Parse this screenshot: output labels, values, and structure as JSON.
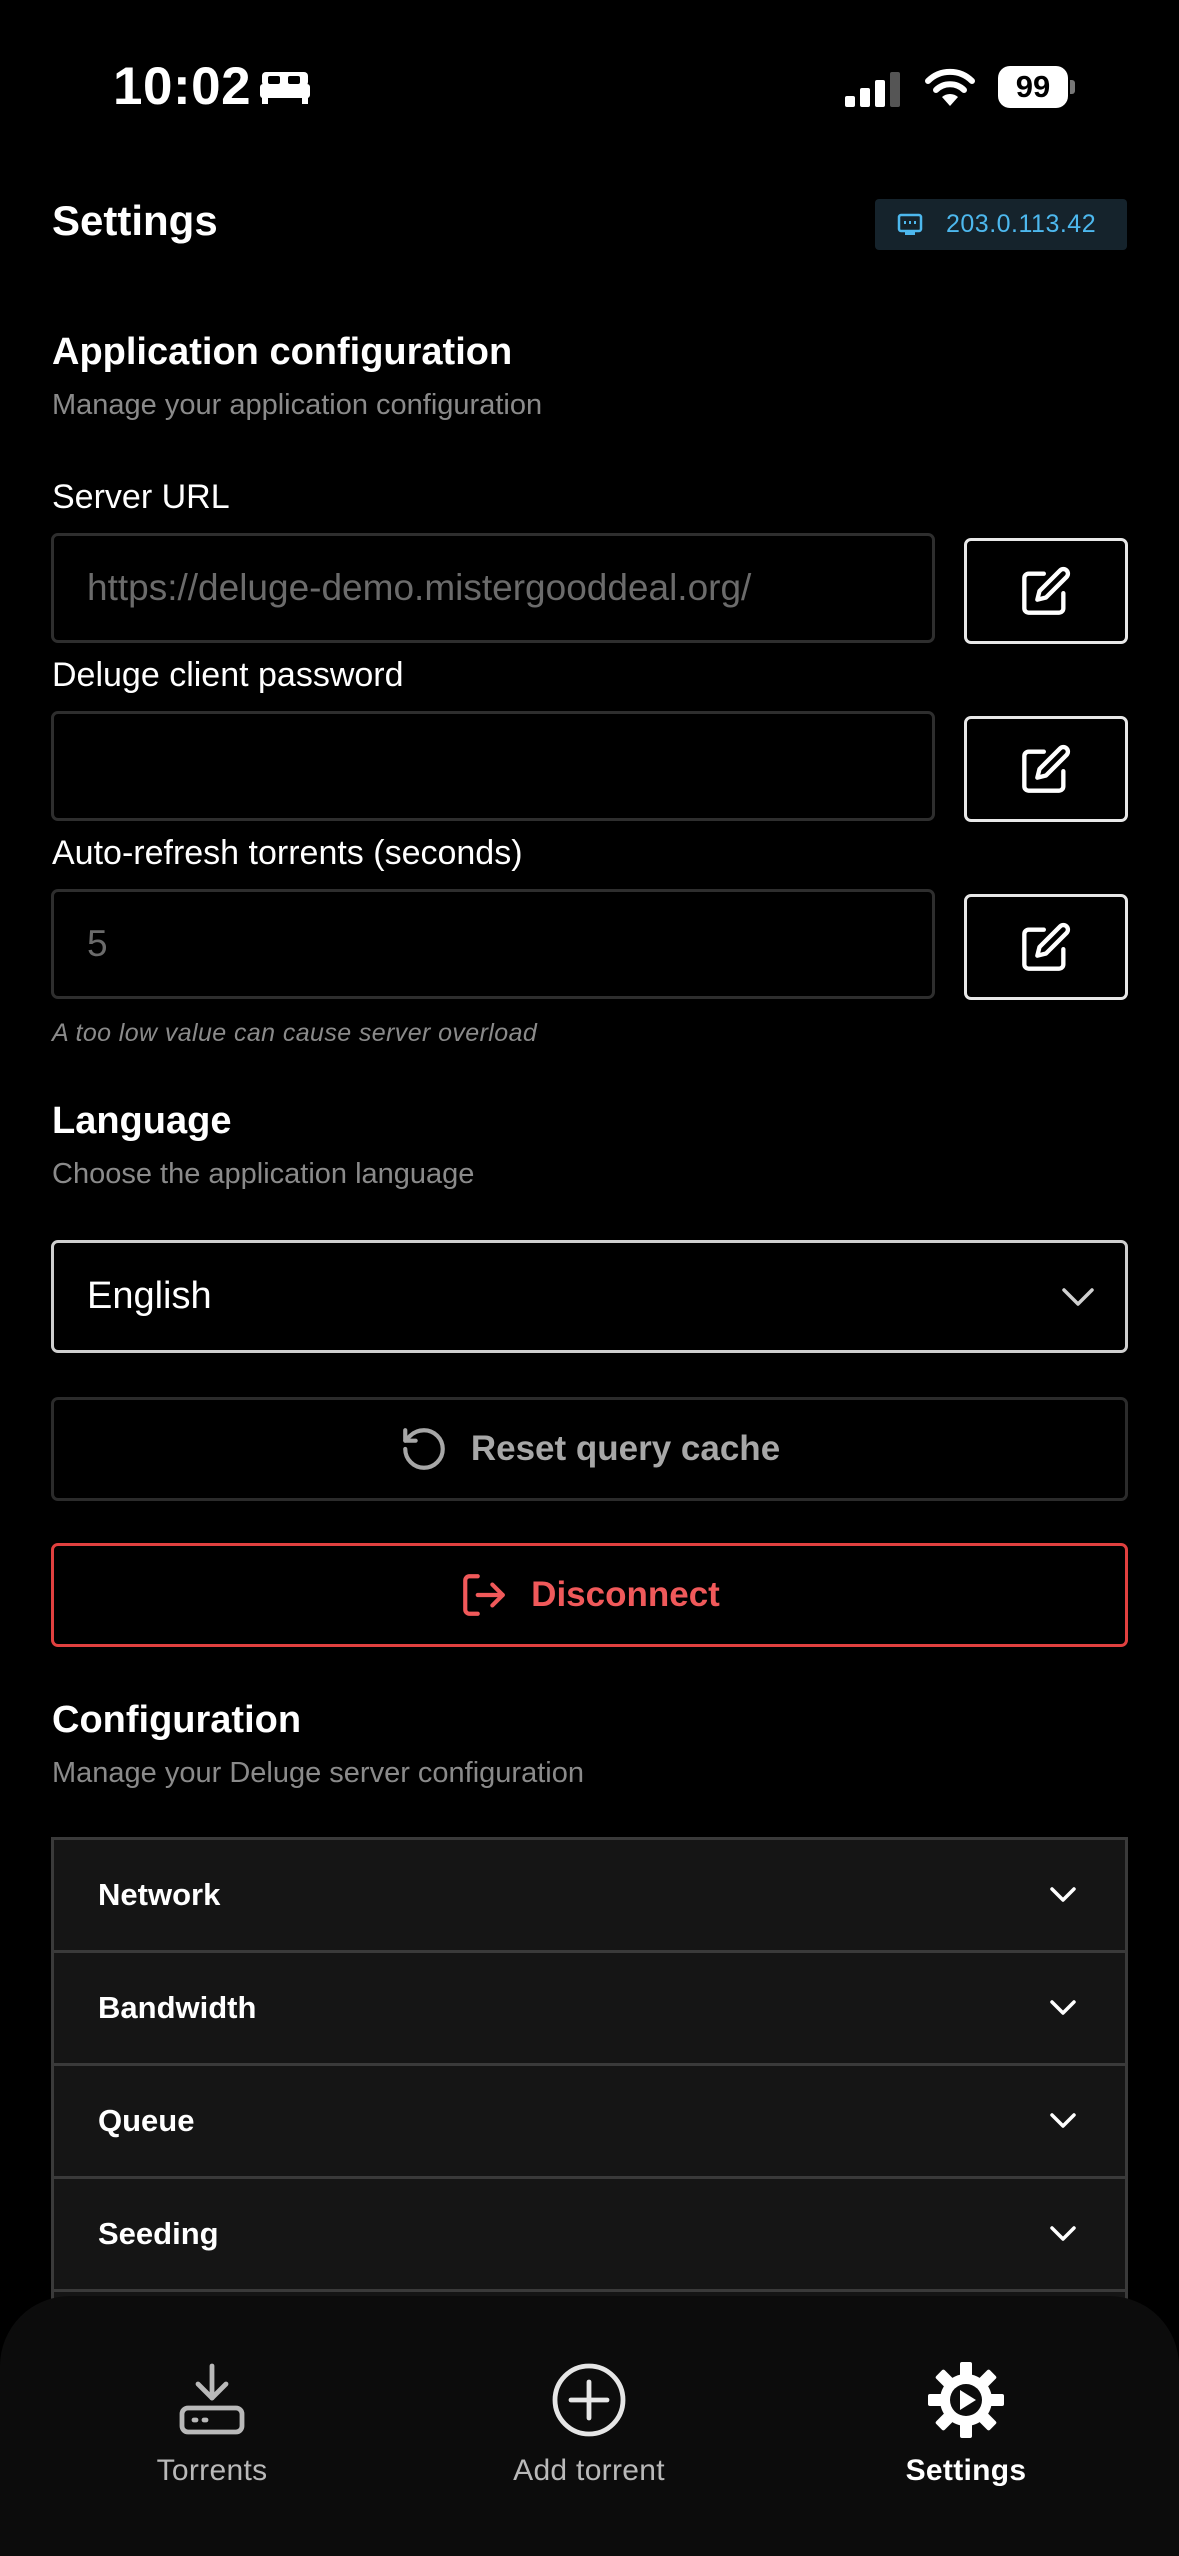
{
  "status_bar": {
    "time": "10:02",
    "battery": "99"
  },
  "header": {
    "title": "Settings",
    "server_ip": "203.0.113.42"
  },
  "app_config": {
    "title": "Application configuration",
    "subtitle": "Manage your application configuration",
    "fields": [
      {
        "label": "Server URL",
        "value": "https://deluge-demo.mistergooddeal.org/"
      },
      {
        "label": "Deluge client password",
        "value": ""
      },
      {
        "label": "Auto-refresh torrents (seconds)",
        "value": "5"
      }
    ],
    "hint": "A too low value can cause server overload"
  },
  "language": {
    "title": "Language",
    "subtitle": "Choose the application language",
    "selected": "English"
  },
  "actions": {
    "reset_label": "Reset query cache",
    "disconnect_label": "Disconnect"
  },
  "configuration": {
    "title": "Configuration",
    "subtitle": "Manage your Deluge server configuration",
    "sections": [
      "Network",
      "Bandwidth",
      "Queue",
      "Seeding"
    ]
  },
  "tabbar": {
    "torrents": "Torrents",
    "add_torrent": "Add torrent",
    "settings": "Settings"
  },
  "colors": {
    "accent_blue": "#4db8ee",
    "danger": "#f0595a",
    "background": "#000000"
  }
}
